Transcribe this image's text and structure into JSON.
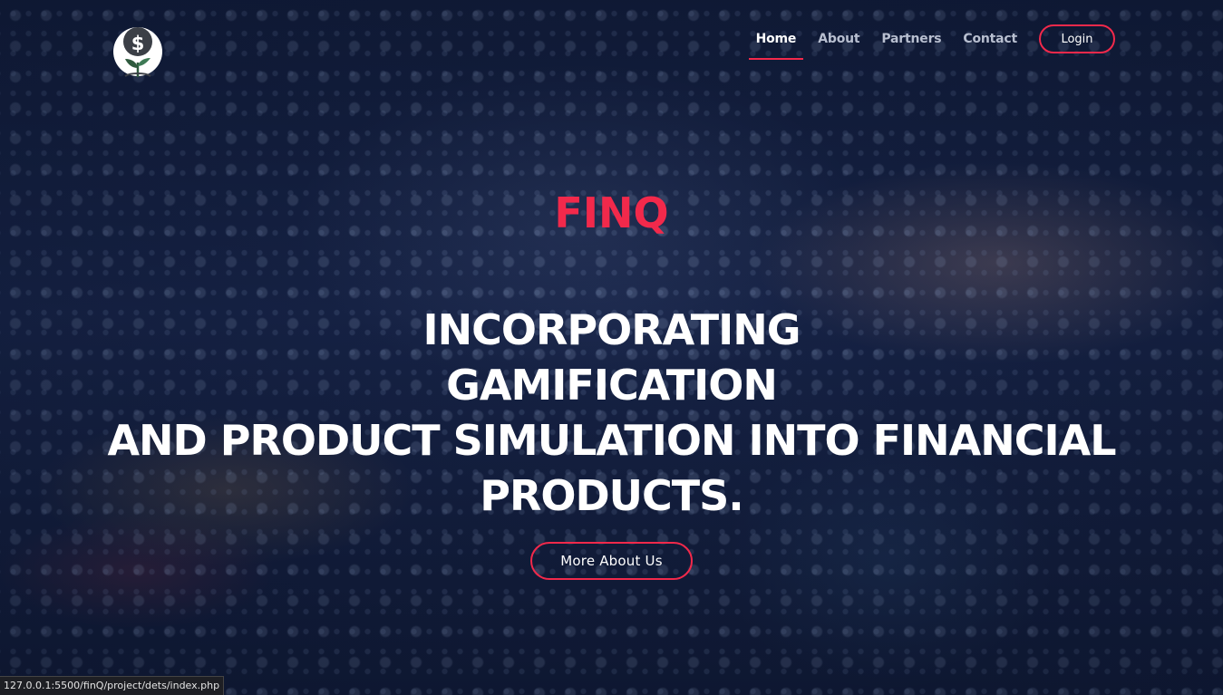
{
  "brand": {
    "logo_icon": "dollar-plant-icon",
    "name": "FINQ"
  },
  "nav": {
    "items": [
      {
        "label": "Home",
        "active": true
      },
      {
        "label": "About",
        "active": false
      },
      {
        "label": "Partners",
        "active": false
      },
      {
        "label": "Contact",
        "active": false
      }
    ],
    "login_label": "Login"
  },
  "hero": {
    "headline_lines": [
      "INCORPORATING",
      "GAMIFICATION",
      "AND PRODUCT SIMULATION INTO FINANCIAL",
      "PRODUCTS."
    ],
    "cta_label": "More About Us"
  },
  "status_bar": {
    "url": "127.0.0.1:5500/finQ/project/dets/index.php"
  },
  "colors": {
    "accent": "#f2294b",
    "text": "#ffffff",
    "nav_inactive": "#b8bfd0",
    "background": "#111c3a"
  }
}
